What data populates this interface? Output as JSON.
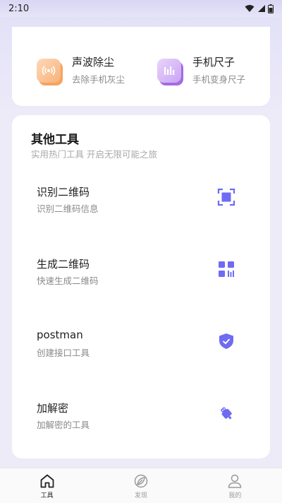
{
  "status_bar": {
    "time": "2:10"
  },
  "top_tools": [
    {
      "title": "声波除尘",
      "subtitle": "去除手机灰尘",
      "icon": "sound-wave-icon"
    },
    {
      "title": "手机尺子",
      "subtitle": "手机变身尺子",
      "icon": "ruler-bars-icon"
    }
  ],
  "other_tools": {
    "title": "其他工具",
    "subtitle": "实用热门工具 开启无限可能之旅",
    "items": [
      {
        "title": "识别二维码",
        "subtitle": "识别二维码信息",
        "icon": "scan-icon"
      },
      {
        "title": "生成二维码",
        "subtitle": "快速生成二维码",
        "icon": "qr-code-icon"
      },
      {
        "title": "postman",
        "subtitle": "创建接口工具",
        "icon": "shield-icon"
      },
      {
        "title": "加解密",
        "subtitle": "加解密的工具",
        "icon": "usb-key-icon"
      }
    ]
  },
  "bottom_nav": [
    {
      "label": "工具",
      "icon": "home-icon",
      "active": true
    },
    {
      "label": "发现",
      "icon": "leaf-icon",
      "active": false
    },
    {
      "label": "我的",
      "icon": "user-icon",
      "active": false
    }
  ],
  "colors": {
    "accent": "#6f6bf2",
    "orange": "#f59a4f",
    "purple": "#a86ae8"
  }
}
